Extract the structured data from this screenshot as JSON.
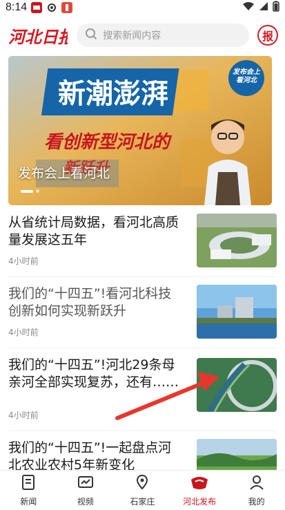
{
  "status_bar": {
    "time": "8:14"
  },
  "header": {
    "logo_text": "河北日报",
    "search_placeholder": "搜索新闻内容",
    "paper_button": "报"
  },
  "banner": {
    "headline_big": "新潮澎湃",
    "headline_sub": "看创新型河北的",
    "headline_sub2": "新跃升",
    "corner_tag": "发布会上看河北",
    "caption": "发布会上看河北",
    "slide_index": 1,
    "slide_count": 2
  },
  "news": [
    {
      "title": "从省统计局数据，看河北高质量发展这五年",
      "time": "4小时前",
      "read": false
    },
    {
      "title": "我们的“十四五”!看河北科技创新如何实现新跃升",
      "time": "4小时前",
      "read": true
    },
    {
      "title": "我们的“十四五”!河北29条母亲河全部实现复苏，还有……",
      "time": "4小时前",
      "read": false
    },
    {
      "title": "我们的“十四五”!一起盘点河北农业农村5年新变化",
      "time": "",
      "read": false
    }
  ],
  "tabbar": {
    "tabs": [
      {
        "label": "新闻",
        "icon": "news-icon",
        "active": false
      },
      {
        "label": "视频",
        "icon": "video-icon",
        "active": false
      },
      {
        "label": "石家庄",
        "icon": "location-icon",
        "active": false
      },
      {
        "label": "河北发布",
        "icon": "hebei-publish-icon",
        "active": true
      },
      {
        "label": "我的",
        "icon": "profile-icon",
        "active": false
      }
    ]
  },
  "colors": {
    "brand_red": "#c8161d",
    "text": "#1a1a1a",
    "muted": "#8a8a8a"
  }
}
